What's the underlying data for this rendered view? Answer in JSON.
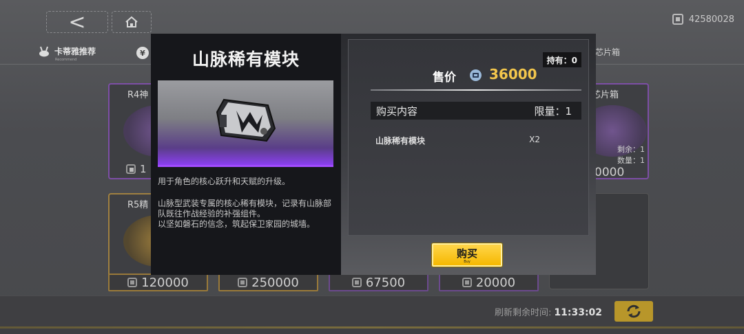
{
  "topbar": {
    "back_icon": "back-arrow-icon",
    "home_icon": "home-icon",
    "currency_icon": "currency-chip-icon",
    "currency_amount": "42580028"
  },
  "tabs": {
    "recommended_label": "卡蒂雅推荐",
    "recommended_sub": "Recommend",
    "second_tab_icon": "yen-icon",
    "right_tab_label": "芯片箱"
  },
  "shop_cards": [
    {
      "name": "R4神",
      "note": ""
    },
    {
      "name": "芯片箱",
      "note": "剩余：1"
    },
    {
      "name": "R5精",
      "note": ""
    }
  ],
  "shop_right_card_quantity": "数量：1",
  "shop_right_card_price": "0000",
  "shop_left_card_price_partial": "1",
  "shop_prices": [
    "120000",
    "250000",
    "67500",
    "20000"
  ],
  "bottom": {
    "refresh_label": "刷新剩余时间:",
    "refresh_time": "11:33:02",
    "refresh_icon": "refresh-icon"
  },
  "modal": {
    "title": "山脉稀有模块",
    "description_1": "用于角色的核心跃升和天赋的升级。",
    "description_2": "山脉型武装专属的核心稀有模块，记录有山脉部队既往作战经验的补强组件。",
    "description_3": "以坚如磐石的信念，筑起保卫家园的城墙。",
    "holding": "持有：0",
    "price_label": "售价",
    "price_value": "36000",
    "content_header": "购买内容",
    "limit_label": "限量：1",
    "content_item": "山脉稀有模块",
    "content_qty": "X2",
    "buy_label": "购买",
    "buy_sub": "Buy"
  },
  "colors": {
    "price": "#f3c64c",
    "buy_button": "#f5b800",
    "rarity": "#a24cff"
  }
}
